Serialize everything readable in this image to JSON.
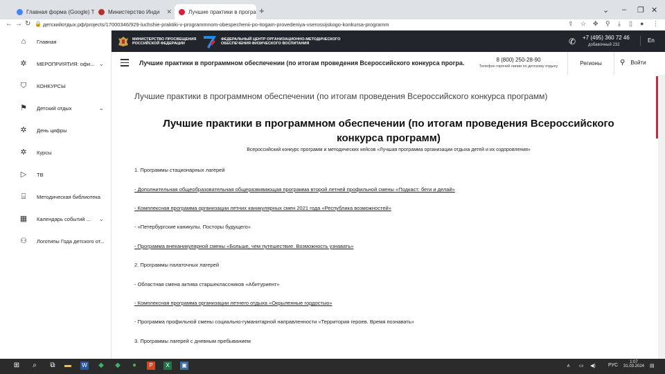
{
  "browser": {
    "tabs": [
      {
        "title": "Главная форма (Google) Тнд",
        "color": "#4285f4"
      },
      {
        "title": "Министерство Инди",
        "color": "#b7312c"
      },
      {
        "title": "Лучшие практики в программ",
        "color": "#d6213a"
      }
    ],
    "url": "детскийотдых.рф/projects/17000346/929-luchshie-praktiki-v-programmnom-obespechenii-po-itogam-provedeniya-vserossijskogo-konkursa-programm"
  },
  "sidebar": {
    "items": [
      {
        "label": "Главная",
        "icon": "home-icon",
        "glyph": "⌂",
        "chevron": false
      },
      {
        "label": "МЕРОПРИЯТИЯ: офи...",
        "icon": "gear-icon",
        "glyph": "✲",
        "chevron": true
      },
      {
        "label": "КОНКУРСЫ",
        "icon": "shield-icon",
        "glyph": "⛉",
        "chevron": false
      },
      {
        "label": "Детский отдых",
        "icon": "flag-icon",
        "glyph": "⚑",
        "chevron": true
      },
      {
        "label": "День цифры",
        "icon": "gear-icon",
        "glyph": "✲",
        "chevron": false
      },
      {
        "label": "Курсы",
        "icon": "gear-icon",
        "glyph": "✲",
        "chevron": false
      },
      {
        "label": "ТВ",
        "icon": "play-icon",
        "glyph": "▷",
        "chevron": false
      },
      {
        "label": "Методическая библиотека",
        "icon": "library-icon",
        "glyph": "⌸",
        "chevron": false
      },
      {
        "label": "Календарь событий ...",
        "icon": "calendar-icon",
        "glyph": "▦",
        "chevron": true
      },
      {
        "label": "Логотипы Года детского от...",
        "icon": "logo-icon",
        "glyph": "⚇",
        "chevron": false
      }
    ]
  },
  "header": {
    "ministry": "МИНИСТЕРСТВО ПРОСВЕЩЕНИЯ РОССИЙСКОЙ ФЕДЕРАЦИИ",
    "center": "ФЕДЕРАЛЬНЫЙ ЦЕНТР ОРГАНИЗАЦИОННО-МЕТОДИЧЕСКОГО ОБЕСПЕЧЕНИЯ ФИЗИЧЕСКОГО ВОСПИТАНИЯ",
    "phone": "+7 (495) 360 72 46",
    "phone_ext": "добавочный 232",
    "lang": "En"
  },
  "subheader": {
    "title": "Лучшие практики в программном обеспечении (по итогам проведения Всероссийского конкурса програ...",
    "hotline_number": "8 (800) 250-28-90",
    "hotline_label": "Телефон горячей линии по детскому отдыху",
    "regions": "Регионы",
    "login": "Войти"
  },
  "content": {
    "breadcrumb_title": "Лучшие практики в программном обеспечении (по итогам проведения Всероссийского конкурса программ)",
    "heading": "Лучшие практики в программном обеспечении (по итогам проведения Всероссийского конкурса программ)",
    "subtitle": "Всероссийский конкурс программ и методических кейсов «Лучшая программа организации отдыха детей и их оздоровления»",
    "lines": [
      {
        "text": "1. Программы стационарных лагерей",
        "link": false
      },
      {
        "text": "- Дополнительная общеобразовательная общеразвивающая программа второй летней профильной смены «Подкаст: беги и делай»",
        "link": true
      },
      {
        "text": "- Комплексная программа организации летних каникулярных смен 2021 года «Республика возможностей»",
        "link": true
      },
      {
        "text": "- «Петербургские каникулы. Посторы будущего»",
        "link": false
      },
      {
        "text": "- Программа внеканикулярной смены «Больше, чем путешествие. Возможность узнавать»",
        "link": true
      },
      {
        "text": "2. Программы палаточных лагерей",
        "link": false
      },
      {
        "text": "- Областная смена актива старшеклассников «Абитуриент»",
        "link": false
      },
      {
        "text": "- Комплексная программа организации летнего отдыха «Окрыленные гордостью»",
        "link": true
      },
      {
        "text": "- Программа профильной смены социально-гуманитарной направленности «Территория героев. Время познавать»",
        "link": false
      },
      {
        "text": "3. Программы лагерей с дневным пребыванием",
        "link": false
      }
    ]
  },
  "taskbar": {
    "lang": "РУС",
    "time": "1:07",
    "date": "31.03.2024"
  }
}
